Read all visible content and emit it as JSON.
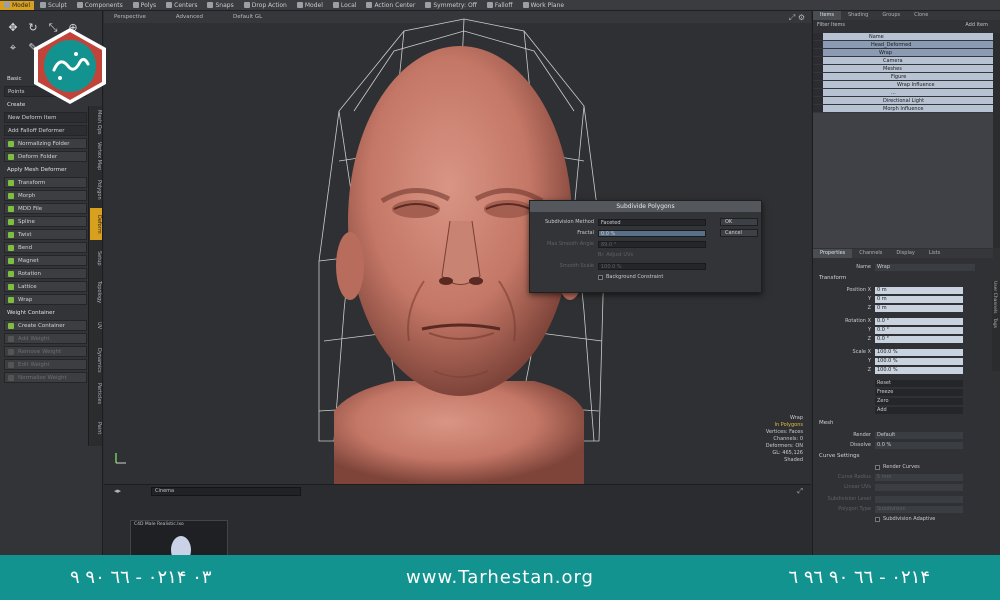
{
  "topbar": {
    "items": [
      "Model",
      "Sculpt",
      "Components",
      "Polys",
      "Centers",
      "Snaps",
      "Drop Action",
      "Model",
      "Local",
      "Action Center",
      "Symmetry: Off",
      "Falloff",
      "Work Plane"
    ],
    "active_index": 0
  },
  "left": {
    "tools": [
      {
        "label": "Basic",
        "style": "header"
      },
      {
        "label": "Points",
        "style": "dropdown"
      },
      {
        "label": "Create",
        "style": "header"
      },
      {
        "label": "New Deform Item",
        "style": "dropdown"
      },
      {
        "label": "Add Falloff Deformer",
        "style": "dropdown"
      },
      {
        "label": "Normalizing Folder",
        "style": "normal"
      },
      {
        "label": "Deform Folder",
        "style": "normal"
      },
      {
        "label": "Apply Mesh Deformer",
        "style": "header"
      },
      {
        "label": "Transform",
        "style": "normal"
      },
      {
        "label": "Morph",
        "style": "normal"
      },
      {
        "label": "MDD File",
        "style": "normal"
      },
      {
        "label": "Spline",
        "style": "normal"
      },
      {
        "label": "Twist",
        "style": "normal"
      },
      {
        "label": "Bend",
        "style": "normal"
      },
      {
        "label": "Magnet",
        "style": "normal"
      },
      {
        "label": "Rotation",
        "style": "normal"
      },
      {
        "label": "Lattice",
        "style": "normal"
      },
      {
        "label": "Wrap",
        "style": "normal"
      },
      {
        "label": "Weight Container",
        "style": "header"
      },
      {
        "label": "Create Container",
        "style": "normal"
      },
      {
        "label": "Add Weight",
        "style": "dim"
      },
      {
        "label": "Remove Weight",
        "style": "dim"
      },
      {
        "label": "Edit Weight",
        "style": "dim"
      },
      {
        "label": "Normalize Weight",
        "style": "dim"
      }
    ],
    "vtabs": [
      "Mesh Ops",
      "Vertex Map",
      "Polygon",
      "Deform",
      "Setup",
      "Topology",
      "UV",
      "Dynamics",
      "Particles",
      "Paint"
    ],
    "vtab_active": 3
  },
  "viewport": {
    "tabs": [
      "Perspective",
      "Advanced",
      "Default GL"
    ],
    "info": [
      {
        "text": "Wrap",
        "yellow": false
      },
      {
        "text": "In Polygons",
        "yellow": true
      },
      {
        "text": "Vertices: Faces",
        "yellow": false
      },
      {
        "text": "Channels: 0",
        "yellow": false
      },
      {
        "text": "Deformers: ON",
        "yellow": false
      },
      {
        "text": "GL: 465,126",
        "yellow": false
      },
      {
        "text": "Shaded",
        "yellow": false
      }
    ]
  },
  "dialog": {
    "title": "Subdivide Polygons",
    "method_label": "Subdivision Method",
    "method_value": "Faceted",
    "fractal_label": "Fractal",
    "fractal_value": "0.0 %",
    "smooth_label": "Max Smooth Angle",
    "smooth_value": "89.0 °",
    "uv_note": "Br. Adjust UVs",
    "scale_label": "Smooth Scale",
    "scale_value": "100.0 %",
    "background_label": "Background Constraint",
    "ok": "OK",
    "cancel": "Cancel"
  },
  "bottom": {
    "field": "Cinema",
    "thumb_title": "C4D Male Realistic.lxo"
  },
  "right": {
    "tabs": [
      "Items",
      "Shading",
      "Groups",
      "Clone"
    ],
    "filter": "Filter Items",
    "add_item": "Add Item",
    "tree": [
      {
        "label": "Name",
        "sel": false,
        "indent": 44
      },
      {
        "label": "Head_Deformed",
        "sel": true,
        "indent": 46
      },
      {
        "label": "Wrap",
        "sel": true,
        "indent": 54
      },
      {
        "label": "Camera",
        "sel": false,
        "indent": 58
      },
      {
        "label": "Meshes",
        "sel": false,
        "indent": 58
      },
      {
        "label": "Figure",
        "sel": false,
        "indent": 66
      },
      {
        "label": "Wrap Influence",
        "sel": false,
        "indent": 72
      },
      {
        "label": "...",
        "sel": false,
        "indent": 66
      },
      {
        "label": "Directional Light",
        "sel": false,
        "indent": 58
      },
      {
        "label": "Morph Influence",
        "sel": false,
        "indent": 58
      }
    ],
    "prop_tabs": [
      "Properties",
      "Channels",
      "Display",
      "Lists"
    ],
    "name_label": "Name",
    "name_value": "Wrap",
    "transform_label": "Transform",
    "position_label": "Position X",
    "position": [
      "0 m",
      "0 m",
      "0 m"
    ],
    "rotation_label": "Rotation X",
    "rotation": [
      "0.0 °",
      "0.0 °",
      "0.0 °"
    ],
    "scale_label": "Scale X",
    "scale": [
      "100.0 %",
      "100.0 %",
      "100.0 %"
    ],
    "axis_labels": [
      "Y",
      "Z"
    ],
    "reset_items": [
      "Reset",
      "Freeze",
      "Zero",
      "Add"
    ],
    "mesh_label": "Mesh",
    "render_label": "Render",
    "render_value": "Default",
    "dissolve_label": "Dissolve",
    "dissolve_value": "0.0 %",
    "curve_label": "Curve Settings",
    "render_curves": "Render Curves",
    "curve_radius_label": "Curve Radius",
    "curve_radius": "5 mm",
    "linear_uvs_label": "Linear UVs",
    "subdiv_level_label": "Subdivision Level",
    "polygon_label": "Polygon Type",
    "polygon_value": "Subdivision",
    "sub_adaptive": "Subdivision Adaptive",
    "vtabs": [
      "User Channels",
      "Tags"
    ]
  },
  "footer": {
    "phone_left": "٠٢١ - ٦٦ ٩٠ ٩۴ ٠٣",
    "url": "www.Tarhestan.org",
    "phone_right": "٠٢١ - ٦٦ ٩٠ ٩٦ ٦۴"
  },
  "colors": {
    "accent": "#d9a020",
    "banner": "#13938f",
    "skin": "#c97e6f"
  }
}
